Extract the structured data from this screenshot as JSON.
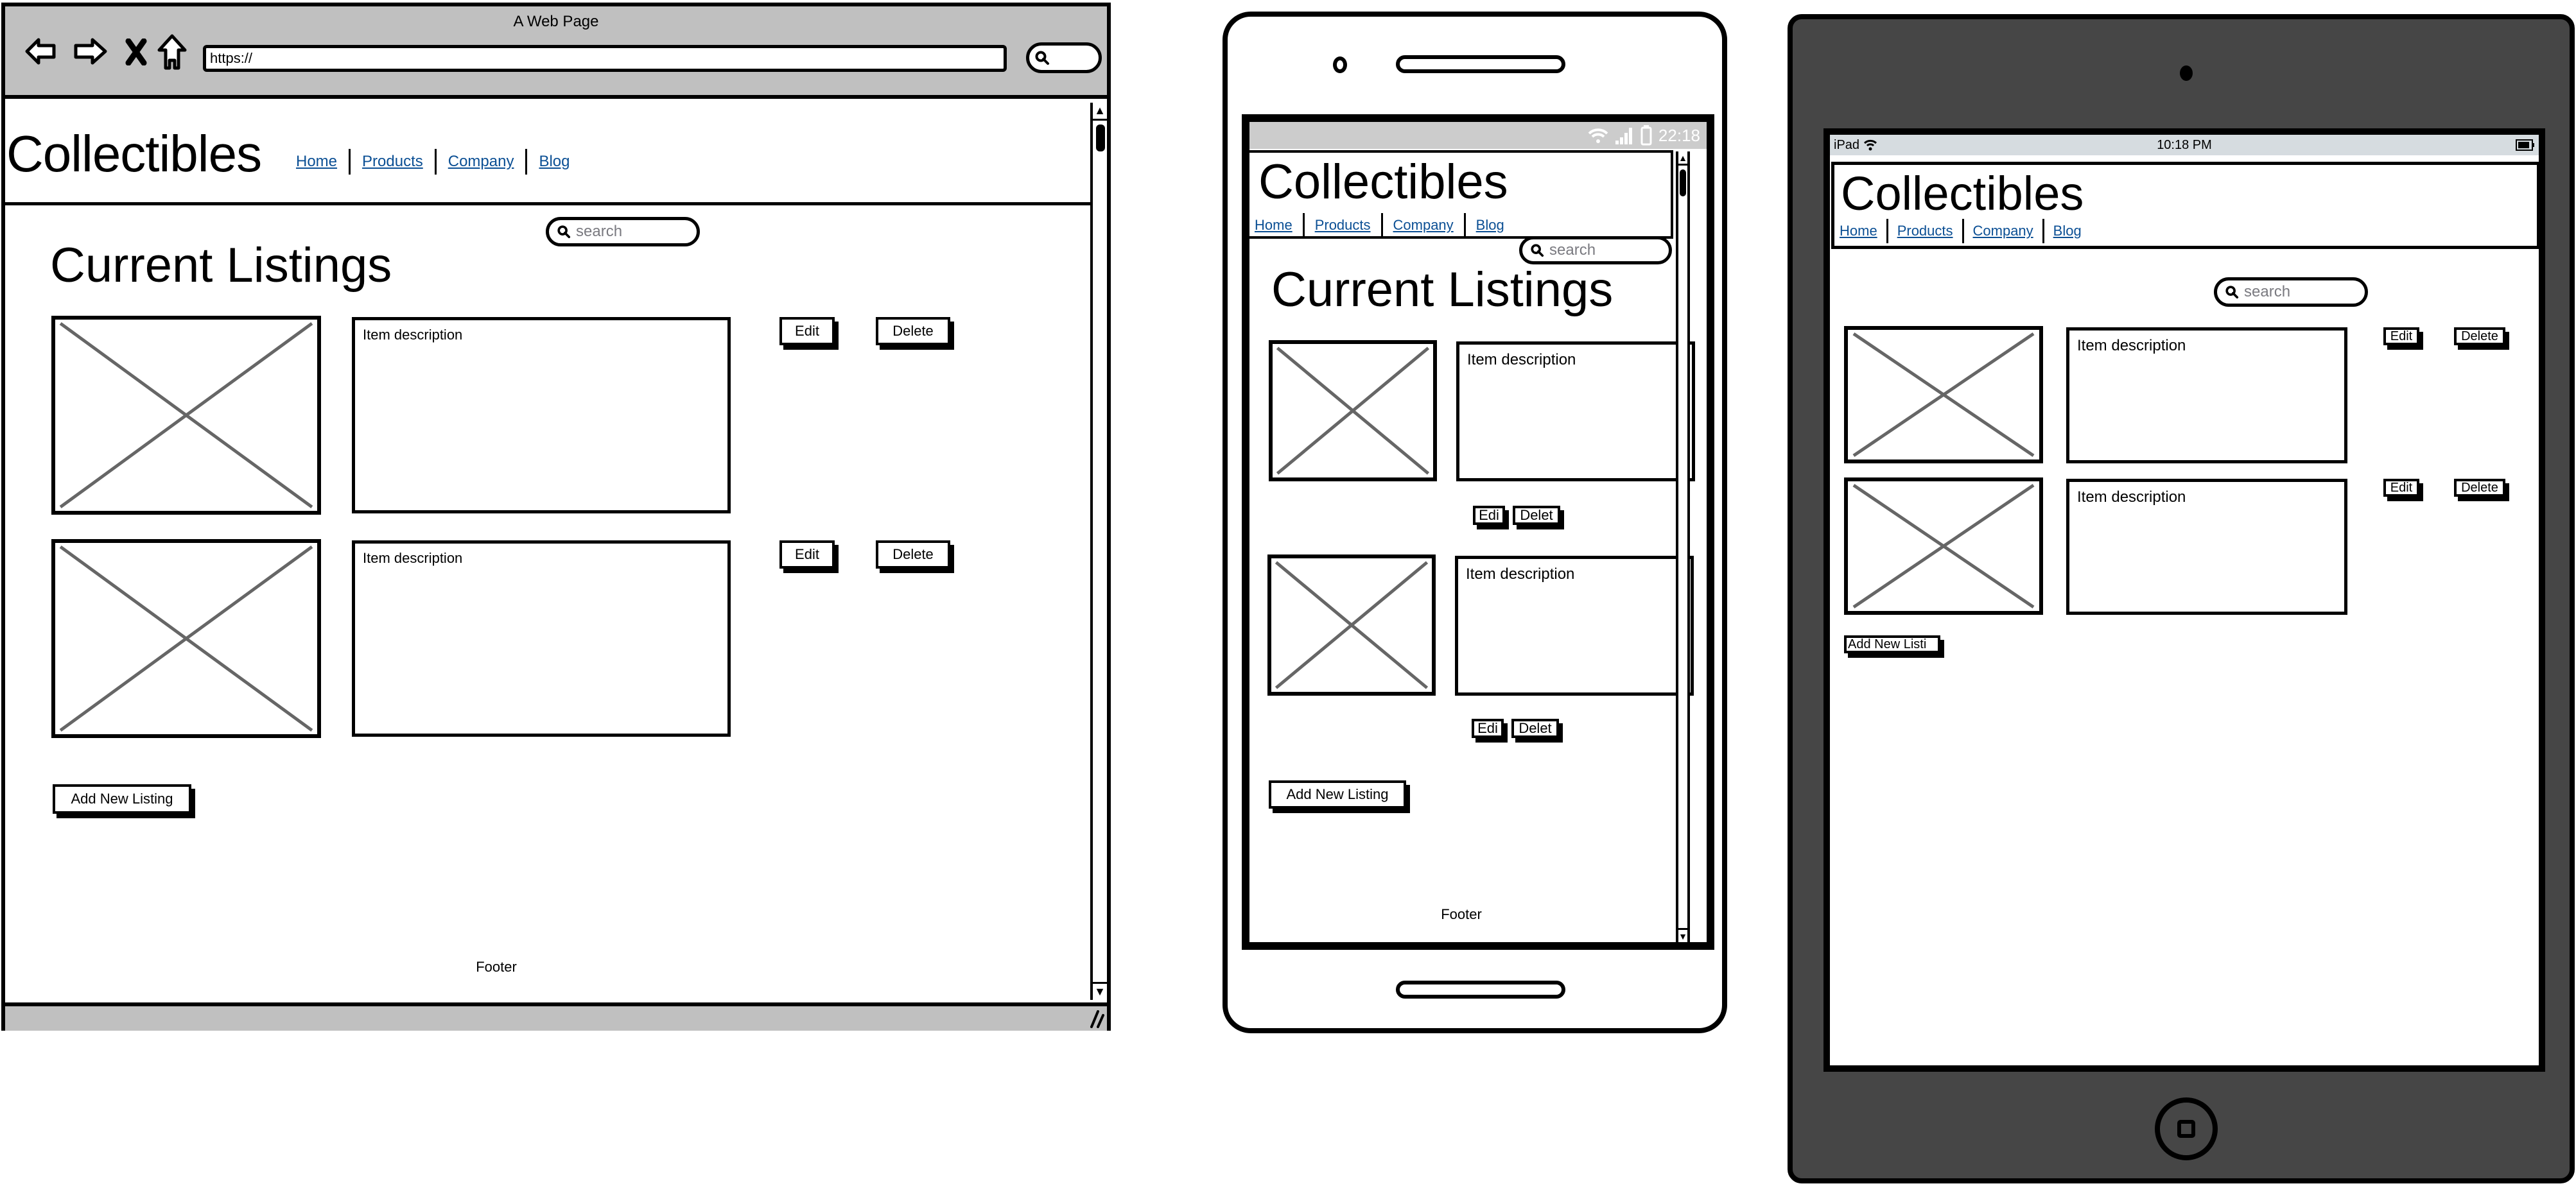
{
  "browser": {
    "window_title": "A Web Page",
    "url": "https://",
    "nav_icons": [
      "back-arrow-icon",
      "forward-arrow-icon",
      "stop-x-icon",
      "home-icon"
    ],
    "search_icon": "search-icon",
    "page": {
      "brand": "Collectibles",
      "nav": [
        "Home",
        "Products",
        "Company",
        "Blog"
      ],
      "search_placeholder": "search",
      "heading": "Current Listings",
      "listings": [
        {
          "description": "Item description",
          "edit_label": "Edit",
          "delete_label": "Delete"
        },
        {
          "description": "Item description",
          "edit_label": "Edit",
          "delete_label": "Delete"
        }
      ],
      "add_button": "Add New Listing",
      "footer": "Footer"
    }
  },
  "phone": {
    "status_time": "22:18",
    "status_icons": [
      "wifi-icon",
      "signal-icon",
      "battery-icon"
    ],
    "page": {
      "brand": "Collectibles",
      "nav": [
        "Home",
        "Products",
        "Company",
        "Blog"
      ],
      "search_placeholder": "search",
      "heading": "Current Listings",
      "listings": [
        {
          "description": "Item description",
          "edit_label": "Edi",
          "delete_label": "Delet"
        },
        {
          "description": "Item description",
          "edit_label": "Edi",
          "delete_label": "Delet"
        }
      ],
      "add_button": "Add New Listing",
      "footer": "Footer"
    }
  },
  "tablet": {
    "status_device": "iPad",
    "status_time": "10:18 PM",
    "status_icons": [
      "wifi-icon",
      "battery-icon"
    ],
    "page": {
      "brand": "Collectibles",
      "nav": [
        "Home",
        "Products",
        "Company",
        "Blog"
      ],
      "search_placeholder": "search",
      "listings": [
        {
          "description": "Item description",
          "edit_label": "Edit",
          "delete_label": "Delete"
        },
        {
          "description": "Item description",
          "edit_label": "Edit",
          "delete_label": "Delete"
        }
      ],
      "add_button": "Add New Listi"
    }
  },
  "colors": {
    "chrome_gray": "#c0c0c0",
    "phone_status_gray": "#cccccc",
    "tablet_status_gray": "#d6dce0",
    "tablet_bezel": "#464646",
    "link_blue": "#0b4f94",
    "placeholder_x": "#666666",
    "search_placeholder": "#7a7a80"
  }
}
